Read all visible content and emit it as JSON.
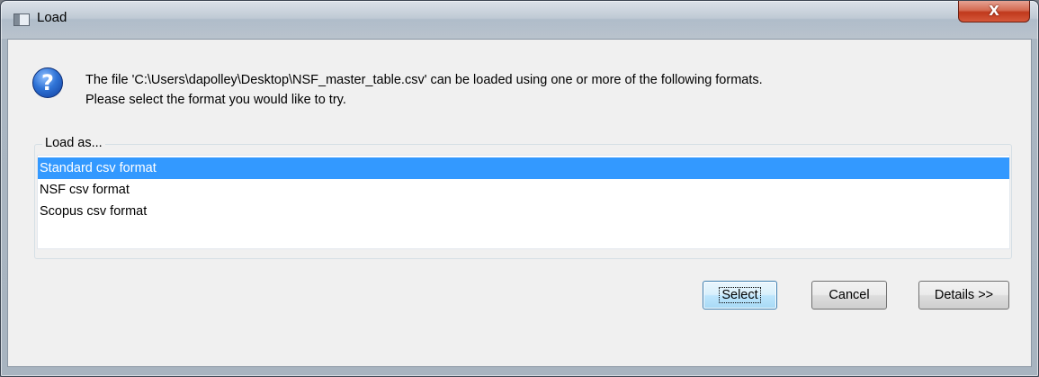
{
  "window": {
    "title": "Load",
    "close_label": "X"
  },
  "message": {
    "line1": "The file 'C:\\Users\\dapolley\\Desktop\\NSF_master_table.csv' can be loaded using one or more of the following formats.",
    "line2": "Please select the format you would like to try."
  },
  "load_as": {
    "label": "Load as...",
    "items": [
      {
        "label": "Standard csv format",
        "selected": true
      },
      {
        "label": "NSF csv format",
        "selected": false
      },
      {
        "label": "Scopus csv format",
        "selected": false
      }
    ]
  },
  "buttons": {
    "select": "Select",
    "cancel": "Cancel",
    "details": "Details >>"
  },
  "icons": {
    "app": "window-icon",
    "question": "question-icon"
  },
  "colors": {
    "selection": "#3399ff",
    "close": "#c7442a"
  }
}
